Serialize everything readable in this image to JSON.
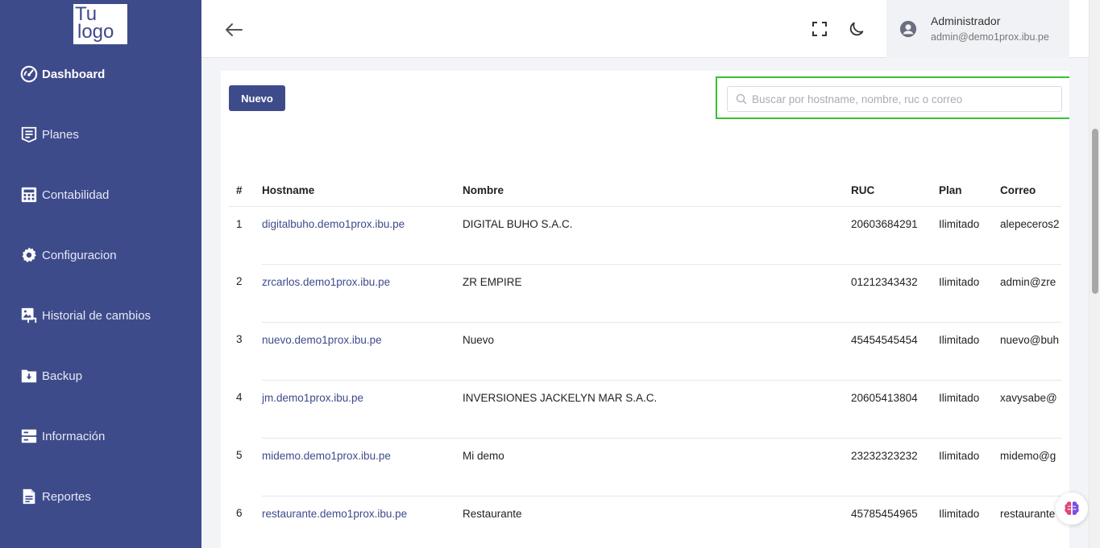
{
  "logo": {
    "line1": "Tu",
    "line2": "logo"
  },
  "sidebar": {
    "items": [
      {
        "label": "Dashboard",
        "icon": "gauge-icon",
        "active": true
      },
      {
        "label": "Planes",
        "icon": "list-doc-icon",
        "active": false
      },
      {
        "label": "Contabilidad",
        "icon": "calculator-icon",
        "active": false
      },
      {
        "label": "Configuracion",
        "icon": "gear-icon",
        "active": false
      },
      {
        "label": "Historial de cambios",
        "icon": "history-image-icon",
        "active": false
      },
      {
        "label": "Backup",
        "icon": "folder-download-icon",
        "active": false
      },
      {
        "label": "Información",
        "icon": "server-icon",
        "active": false
      },
      {
        "label": "Reportes",
        "icon": "document-icon",
        "active": false
      }
    ]
  },
  "header": {
    "user_name": "Administrador",
    "user_email": "admin@demo1prox.ibu.pe"
  },
  "toolbar": {
    "new_label": "Nuevo",
    "search_placeholder": "Buscar por hostname, nombre, ruc o correo",
    "search_value": ""
  },
  "table": {
    "headers": [
      "#",
      "Hostname",
      "Nombre",
      "RUC",
      "Plan",
      "Correo"
    ],
    "rows": [
      [
        "1",
        "digitalbuho.demo1prox.ibu.pe",
        "DIGITAL BUHO S.A.C.",
        "20603684291",
        "Ilimitado",
        "alepeceros2"
      ],
      [
        "2",
        "zrcarlos.demo1prox.ibu.pe",
        "ZR EMPIRE",
        "01212343432",
        "Ilimitado",
        "admin@zre"
      ],
      [
        "3",
        "nuevo.demo1prox.ibu.pe",
        "Nuevo",
        "45454545454",
        "Ilimitado",
        "nuevo@buh"
      ],
      [
        "4",
        "jm.demo1prox.ibu.pe",
        "INVERSIONES JACKELYN MAR S.A.C.",
        "20605413804",
        "Ilimitado",
        "xavysabe@"
      ],
      [
        "5",
        "midemo.demo1prox.ibu.pe",
        "Mi demo",
        "23232323232",
        "Ilimitado",
        "midemo@g"
      ],
      [
        "6",
        "restaurante.demo1prox.ibu.pe",
        "Restaurante",
        "45785454965",
        "Ilimitado",
        "restaurante"
      ]
    ]
  },
  "colors": {
    "sidebar": "#3e4b8b",
    "accent": "#3e4b8b",
    "highlight": "#37c231"
  }
}
